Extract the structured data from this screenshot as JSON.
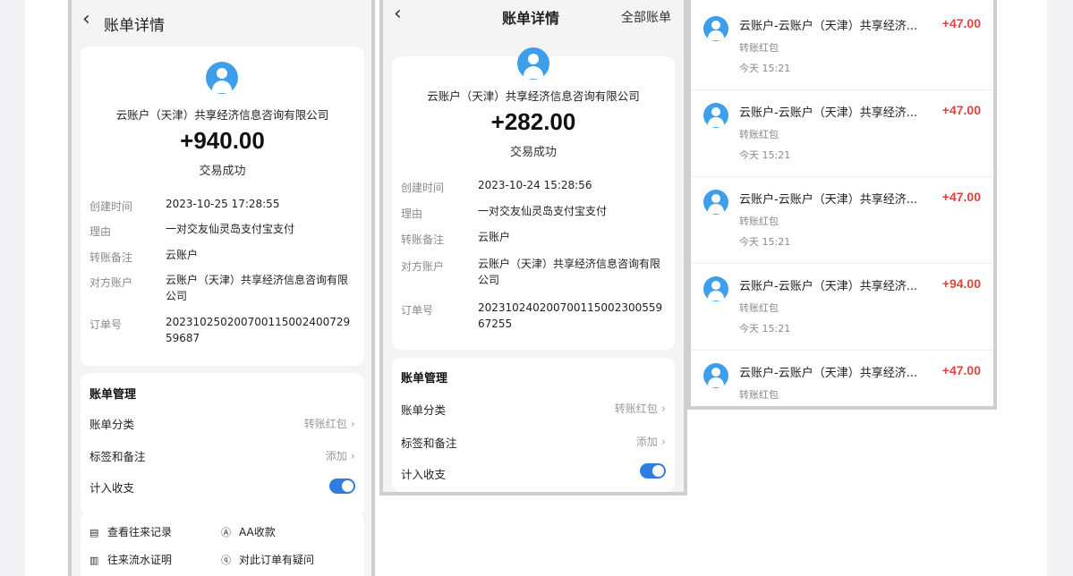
{
  "colors": {
    "accent": "#2f7de1",
    "avatar": "#3d9eec",
    "amount_red": "#e0443a"
  },
  "panel1": {
    "back_icon": "back-arrow-icon",
    "title": "账单详情",
    "company": "云账户（天津）共享经济信息咨询有限公司",
    "amount": "+940.00",
    "status": "交易成功",
    "details": [
      {
        "label": "创建时间",
        "value": "2023-10-25 17:28:55"
      },
      {
        "label": "理由",
        "value": "一对交友仙灵岛支付宝支付"
      },
      {
        "label": "转账备注",
        "value": "云账户"
      },
      {
        "label": "对方账户",
        "value": "云账户（天津）共享经济信息咨询有限公司"
      },
      {
        "label": "订单号",
        "value": "20231025020070011500240072959687"
      }
    ],
    "manage_title": "账单管理",
    "category_label": "账单分类",
    "category_value": "转账红包",
    "tags_label": "标签和备注",
    "tags_value": "添加",
    "income_label": "计入收支",
    "income_on": true,
    "links": [
      "查看往来记录",
      "AA收款",
      "往来流水证明",
      "对此订单有疑问"
    ]
  },
  "panel2": {
    "back_icon": "back-arrow-icon",
    "title": "账单详情",
    "right": "全部账单",
    "company": "云账户（天津）共享经济信息咨询有限公司",
    "amount": "+282.00",
    "status": "交易成功",
    "details": [
      {
        "label": "创建时间",
        "value": "2023-10-24 15:28:56"
      },
      {
        "label": "理由",
        "value": "一对交友仙灵岛支付宝支付"
      },
      {
        "label": "转账备注",
        "value": "云账户"
      },
      {
        "label": "对方账户",
        "value": "云账户（天津）共享经济信息咨询有限公司"
      },
      {
        "label": "订单号",
        "value": "20231024020070011500230055967255"
      }
    ],
    "manage_title": "账单管理",
    "category_label": "账单分类",
    "category_value": "转账红包",
    "tags_label": "标签和备注",
    "tags_value": "添加",
    "income_label": "计入收支",
    "income_on": true
  },
  "panel3": {
    "items": [
      {
        "title": "云账户-云账户（天津）共享经济...",
        "amount": "+47.00",
        "sub": "转账红包",
        "time": "今天 15:21"
      },
      {
        "title": "云账户-云账户（天津）共享经济...",
        "amount": "+47.00",
        "sub": "转账红包",
        "time": "今天 15:21"
      },
      {
        "title": "云账户-云账户（天津）共享经济...",
        "amount": "+47.00",
        "sub": "转账红包",
        "time": "今天 15:21"
      },
      {
        "title": "云账户-云账户（天津）共享经济...",
        "amount": "+94.00",
        "sub": "转账红包",
        "time": "今天 15:21"
      },
      {
        "title": "云账户-云账户（天津）共享经济...",
        "amount": "+47.00",
        "sub": "转账红包",
        "time": ""
      }
    ]
  }
}
